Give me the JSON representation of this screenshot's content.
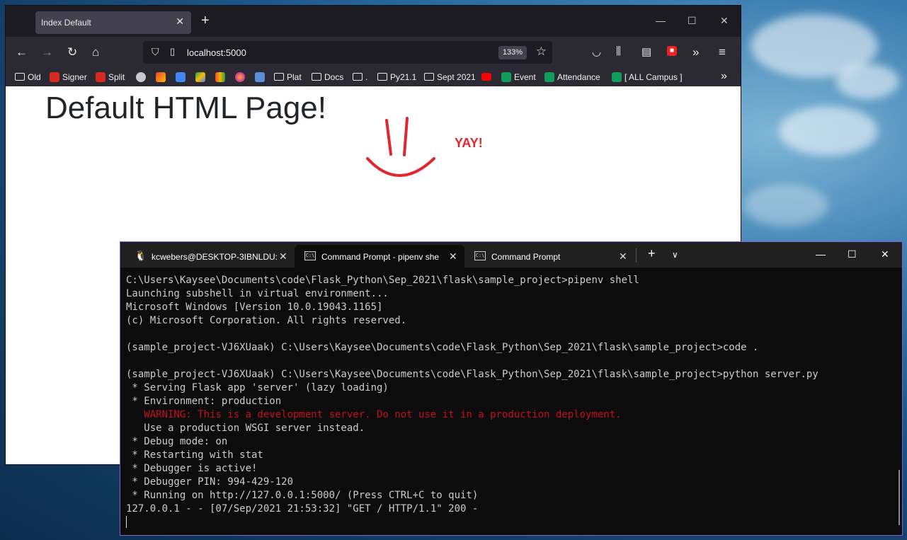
{
  "browser": {
    "tab_title": "Index Default",
    "url": "localhost:5000",
    "zoom": "133%",
    "bookmarks": [
      {
        "label": "Old",
        "icon": "folder-icon"
      },
      {
        "label": "Signer",
        "icon": "acrobat-icon"
      },
      {
        "label": "Split",
        "icon": "acrobat-icon"
      },
      {
        "label": "",
        "icon": "cloud-icon"
      },
      {
        "label": "",
        "icon": "gmail-icon"
      },
      {
        "label": "",
        "icon": "calendar-icon"
      },
      {
        "label": "",
        "icon": "drive-icon"
      },
      {
        "label": "",
        "icon": "meet-icon"
      },
      {
        "label": "",
        "icon": "circle-icon"
      },
      {
        "label": "",
        "icon": "torii-icon"
      },
      {
        "label": "Plat",
        "icon": "folder-icon"
      },
      {
        "label": "Docs",
        "icon": "folder-icon"
      },
      {
        "label": ".",
        "icon": "folder-icon"
      },
      {
        "label": "Py21.1",
        "icon": "folder-icon"
      },
      {
        "label": "Sept 2021",
        "icon": "folder-icon"
      },
      {
        "label": "",
        "icon": "youtube-icon"
      },
      {
        "label": "Event",
        "icon": "sheets-icon"
      },
      {
        "label": "Attendance",
        "icon": "sheets-icon"
      },
      {
        "label": "[ ALL Campus ]",
        "icon": "sheets-icon"
      }
    ]
  },
  "page": {
    "heading": "Default HTML Page!",
    "yay": "YAY!"
  },
  "terminal": {
    "tabs": [
      {
        "label": "kcwebers@DESKTOP-3IBNLDU:",
        "icon": "linux-penguin-icon"
      },
      {
        "label": "Command Prompt - pipenv  she",
        "icon": "cmd-icon"
      },
      {
        "label": "Command Prompt",
        "icon": "cmd-icon"
      }
    ],
    "lines": [
      "C:\\Users\\Kaysee\\Documents\\code\\Flask_Python\\Sep_2021\\flask\\sample_project>pipenv shell",
      "Launching subshell in virtual environment...",
      "Microsoft Windows [Version 10.0.19043.1165]",
      "(c) Microsoft Corporation. All rights reserved.",
      "",
      "(sample_project-VJ6XUaak) C:\\Users\\Kaysee\\Documents\\code\\Flask_Python\\Sep_2021\\flask\\sample_project>code .",
      "",
      "(sample_project-VJ6XUaak) C:\\Users\\Kaysee\\Documents\\code\\Flask_Python\\Sep_2021\\flask\\sample_project>python server.py",
      " * Serving Flask app 'server' (lazy loading)",
      " * Environment: production",
      "   WARNING: This is a development server. Do not use it in a production deployment.",
      "   Use a production WSGI server instead.",
      " * Debug mode: on",
      " * Restarting with stat",
      " * Debugger is active!",
      " * Debugger PIN: 994-429-120",
      " * Running on http://127.0.0.1:5000/ (Press CTRL+C to quit)",
      "127.0.0.1 - - [07/Sep/2021 21:53:32] \"GET / HTTP/1.1\" 200 -"
    ],
    "warning_line_index": 10,
    "colors": {
      "warning": "#c50f1f",
      "text": "#cccccc",
      "background": "#0c0c0c"
    }
  }
}
